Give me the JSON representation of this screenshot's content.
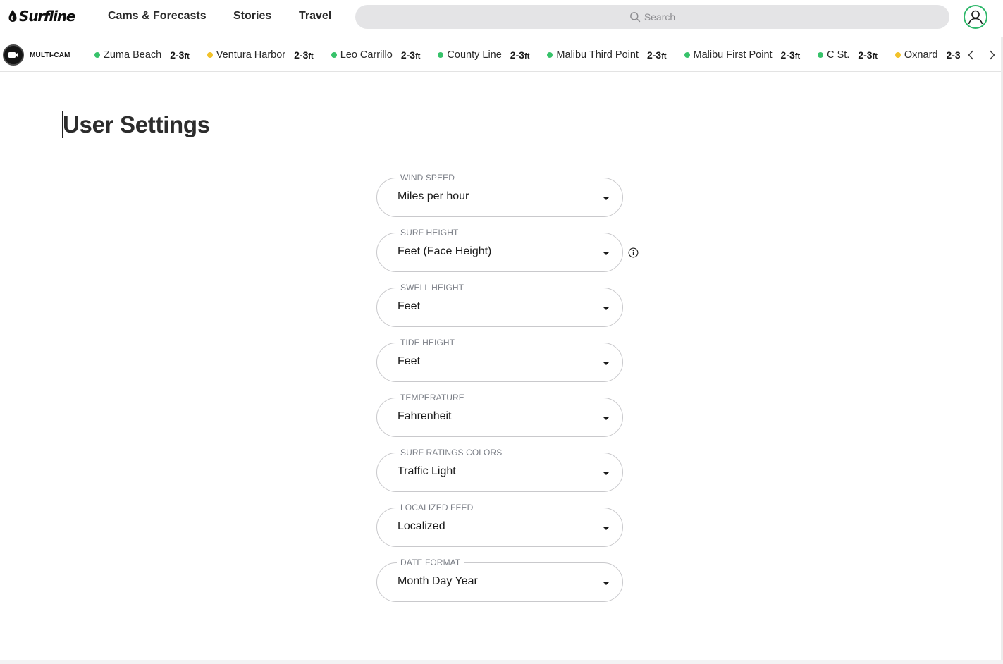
{
  "header": {
    "logo_text": "Surfline",
    "nav": [
      "Cams & Forecasts",
      "Stories",
      "Travel"
    ],
    "search_placeholder": "Search"
  },
  "cambar": {
    "multicam_label": "MULTI-CAM",
    "unit": "ft",
    "spots": [
      {
        "name": "Zuma Beach",
        "height": "2-3",
        "status_color": "#37c26a"
      },
      {
        "name": "Ventura Harbor",
        "height": "2-3",
        "status_color": "#f2c22a"
      },
      {
        "name": "Leo Carrillo",
        "height": "2-3",
        "status_color": "#37c26a"
      },
      {
        "name": "County Line",
        "height": "2-3",
        "status_color": "#37c26a"
      },
      {
        "name": "Malibu Third Point",
        "height": "2-3",
        "status_color": "#37c26a"
      },
      {
        "name": "Malibu First Point",
        "height": "2-3",
        "status_color": "#37c26a"
      },
      {
        "name": "C St.",
        "height": "2-3",
        "status_color": "#37c26a"
      },
      {
        "name": "Oxnard",
        "height": "2-3",
        "status_color": "#f2c22a"
      }
    ]
  },
  "page": {
    "title": "User Settings"
  },
  "settings": [
    {
      "label": "Wind Speed",
      "value": "Miles per hour"
    },
    {
      "label": "Surf Height",
      "value": "Feet (Face Height)"
    },
    {
      "label": "Swell Height",
      "value": "Feet"
    },
    {
      "label": "Tide Height",
      "value": "Feet"
    },
    {
      "label": "Temperature",
      "value": "Fahrenheit"
    },
    {
      "label": "Surf Ratings Colors",
      "value": "Traffic Light"
    },
    {
      "label": "Localized Feed",
      "value": "Localized"
    },
    {
      "label": "Date Format",
      "value": "Month Day Year"
    }
  ]
}
